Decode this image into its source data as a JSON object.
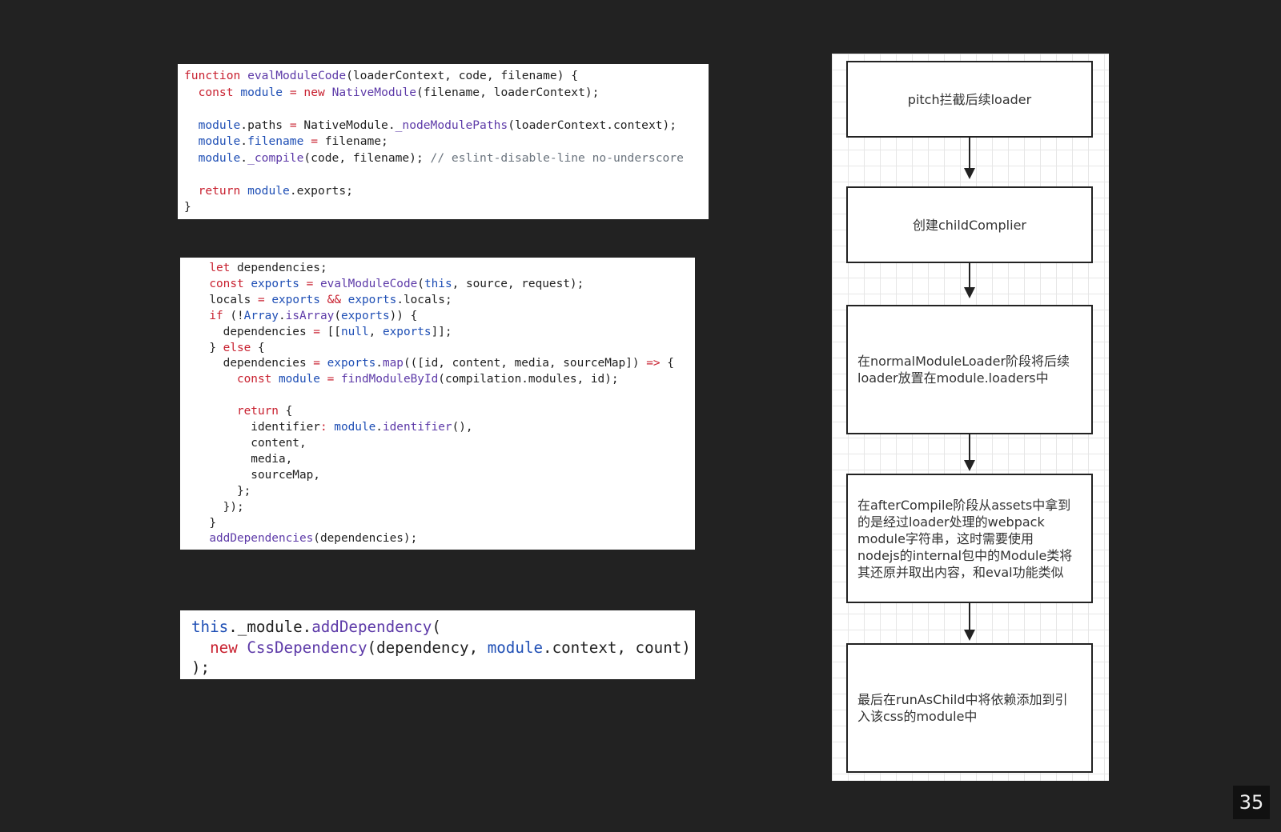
{
  "code_block_1": [
    [
      [
        "kw",
        "function"
      ],
      [
        "p",
        " "
      ],
      [
        "fn",
        "evalModuleCode"
      ],
      [
        "p",
        "(loaderContext, code, filename) {"
      ]
    ],
    [
      [
        "p",
        "  "
      ],
      [
        "kw",
        "const"
      ],
      [
        "p",
        " "
      ],
      [
        "var",
        "module"
      ],
      [
        "p",
        " "
      ],
      [
        "kw",
        "="
      ],
      [
        "p",
        " "
      ],
      [
        "kw",
        "new"
      ],
      [
        "p",
        " "
      ],
      [
        "fn",
        "NativeModule"
      ],
      [
        "p",
        "(filename, loaderContext);"
      ]
    ],
    [],
    [
      [
        "p",
        "  "
      ],
      [
        "var",
        "module"
      ],
      [
        "p",
        ".paths "
      ],
      [
        "kw",
        "="
      ],
      [
        "p",
        " NativeModule."
      ],
      [
        "fn",
        "_nodeModulePaths"
      ],
      [
        "p",
        "(loaderContext.context);"
      ]
    ],
    [
      [
        "p",
        "  "
      ],
      [
        "var",
        "module"
      ],
      [
        "p",
        "."
      ],
      [
        "var",
        "filename"
      ],
      [
        "p",
        " "
      ],
      [
        "kw",
        "="
      ],
      [
        "p",
        " filename;"
      ]
    ],
    [
      [
        "p",
        "  "
      ],
      [
        "var",
        "module"
      ],
      [
        "p",
        "."
      ],
      [
        "fn",
        "_compile"
      ],
      [
        "p",
        "(code, filename); "
      ],
      [
        "cm",
        "// eslint-disable-line no-underscore"
      ]
    ],
    [],
    [
      [
        "p",
        "  "
      ],
      [
        "kw",
        "return"
      ],
      [
        "p",
        " "
      ],
      [
        "var",
        "module"
      ],
      [
        "p",
        ".exports;"
      ]
    ],
    [
      [
        "p",
        "}"
      ]
    ]
  ],
  "code_block_2": [
    [
      [
        "p",
        "  "
      ],
      [
        "kw",
        "let"
      ],
      [
        "p",
        " dependencies;"
      ]
    ],
    [
      [
        "p",
        "  "
      ],
      [
        "kw",
        "const"
      ],
      [
        "p",
        " "
      ],
      [
        "var",
        "exports"
      ],
      [
        "p",
        " "
      ],
      [
        "kw",
        "="
      ],
      [
        "p",
        " "
      ],
      [
        "fn",
        "evalModuleCode"
      ],
      [
        "p",
        "("
      ],
      [
        "var",
        "this"
      ],
      [
        "p",
        ", source, request);"
      ]
    ],
    [
      [
        "p",
        "  locals "
      ],
      [
        "kw",
        "="
      ],
      [
        "p",
        " "
      ],
      [
        "var",
        "exports"
      ],
      [
        "p",
        " "
      ],
      [
        "kw",
        "&&"
      ],
      [
        "p",
        " "
      ],
      [
        "var",
        "exports"
      ],
      [
        "p",
        ".locals;"
      ]
    ],
    [
      [
        "p",
        "  "
      ],
      [
        "kw",
        "if"
      ],
      [
        "p",
        " (!"
      ],
      [
        "var",
        "Array"
      ],
      [
        "p",
        "."
      ],
      [
        "fn",
        "isArray"
      ],
      [
        "p",
        "("
      ],
      [
        "var",
        "exports"
      ],
      [
        "p",
        ")) {"
      ]
    ],
    [
      [
        "p",
        "    dependencies "
      ],
      [
        "kw",
        "="
      ],
      [
        "p",
        " [["
      ],
      [
        "var",
        "null"
      ],
      [
        "p",
        ", "
      ],
      [
        "var",
        "exports"
      ],
      [
        "p",
        "]];"
      ]
    ],
    [
      [
        "p",
        "  } "
      ],
      [
        "kw",
        "else"
      ],
      [
        "p",
        " {"
      ]
    ],
    [
      [
        "p",
        "    dependencies "
      ],
      [
        "kw",
        "="
      ],
      [
        "p",
        " "
      ],
      [
        "var",
        "exports"
      ],
      [
        "p",
        "."
      ],
      [
        "fn",
        "map"
      ],
      [
        "p",
        "(([id, content, media, sourceMap]) "
      ],
      [
        "kw",
        "=>"
      ],
      [
        "p",
        " {"
      ]
    ],
    [
      [
        "p",
        "      "
      ],
      [
        "kw",
        "const"
      ],
      [
        "p",
        " "
      ],
      [
        "var",
        "module"
      ],
      [
        "p",
        " "
      ],
      [
        "kw",
        "="
      ],
      [
        "p",
        " "
      ],
      [
        "fn",
        "findModuleById"
      ],
      [
        "p",
        "(compilation.modules, id);"
      ]
    ],
    [],
    [
      [
        "p",
        "      "
      ],
      [
        "kw",
        "return"
      ],
      [
        "p",
        " {"
      ]
    ],
    [
      [
        "p",
        "        identifier"
      ],
      [
        "kw",
        ":"
      ],
      [
        "p",
        " "
      ],
      [
        "var",
        "module"
      ],
      [
        "p",
        "."
      ],
      [
        "fn",
        "identifier"
      ],
      [
        "p",
        "(),"
      ]
    ],
    [
      [
        "p",
        "        content,"
      ]
    ],
    [
      [
        "p",
        "        media,"
      ]
    ],
    [
      [
        "p",
        "        sourceMap,"
      ]
    ],
    [
      [
        "p",
        "      };"
      ]
    ],
    [
      [
        "p",
        "    });"
      ]
    ],
    [
      [
        "p",
        "  }"
      ]
    ],
    [
      [
        "p",
        "  "
      ],
      [
        "fn",
        "addDependencies"
      ],
      [
        "p",
        "(dependencies);"
      ]
    ]
  ],
  "code_block_3": [
    [
      [
        "var",
        "this"
      ],
      [
        "p",
        "._module."
      ],
      [
        "fn",
        "addDependency"
      ],
      [
        "p",
        "("
      ]
    ],
    [
      [
        "p",
        "  "
      ],
      [
        "kw",
        "new"
      ],
      [
        "p",
        " "
      ],
      [
        "fn",
        "CssDependency"
      ],
      [
        "p",
        "(dependency, "
      ],
      [
        "var",
        "module"
      ],
      [
        "p",
        ".context, count)"
      ]
    ],
    [
      [
        "p",
        ");"
      ]
    ]
  ],
  "flowchart": {
    "steps": [
      "pitch拦截后续loader",
      "创建childComplier",
      "在normalModuleLoader阶段将后续\nloader放置在module.loaders中",
      "在afterCompile阶段从assets中拿到\n的是经过loader处理的webpack\nmodule字符串，这时需要使用\nnodejs的internal包中的Module类将\n其还原并取出内容，和eval功能类似",
      "最后在runAsChild中将依赖添加到引\n入该css的module中"
    ]
  },
  "page_number": "35",
  "colors": {
    "background": "#222222",
    "keyword": "#c8202f",
    "function": "#5d3aa8",
    "variable": "#1f4fb5",
    "comment": "#6a737d"
  }
}
